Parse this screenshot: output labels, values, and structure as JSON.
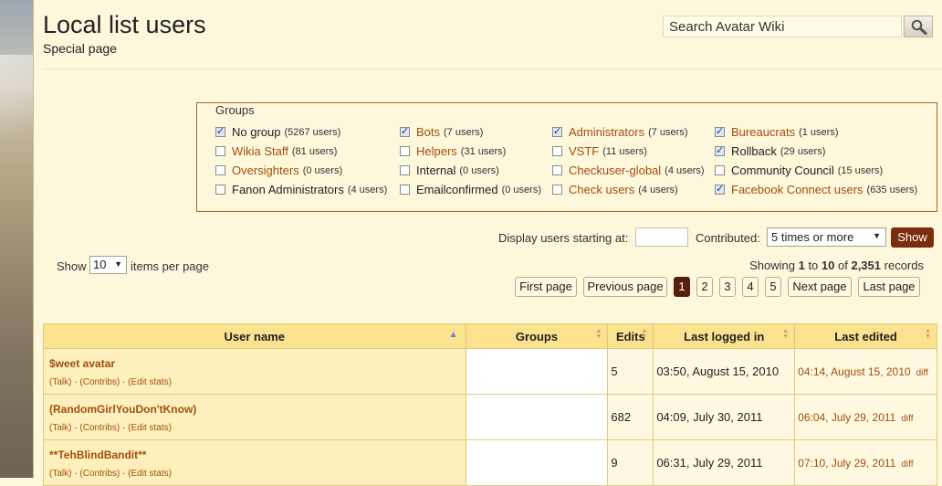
{
  "header": {
    "title": "Local list users",
    "subtitle": "Special page",
    "search_placeholder": "Search Avatar Wiki"
  },
  "groups": {
    "legend": "Groups",
    "items": [
      {
        "label": "No group",
        "count": "(5267 users)",
        "checked": true,
        "link": false
      },
      {
        "label": "Bots",
        "count": "(7 users)",
        "checked": true,
        "link": true
      },
      {
        "label": "Administrators",
        "count": "(7 users)",
        "checked": true,
        "link": true
      },
      {
        "label": "Bureaucrats",
        "count": "(1 users)",
        "checked": true,
        "link": true
      },
      {
        "label": "Wikia Staff",
        "count": "(81 users)",
        "checked": false,
        "link": true
      },
      {
        "label": "Helpers",
        "count": "(31 users)",
        "checked": false,
        "link": true
      },
      {
        "label": "VSTF",
        "count": "(11 users)",
        "checked": false,
        "link": true
      },
      {
        "label": "Rollback",
        "count": "(29 users)",
        "checked": true,
        "link": false
      },
      {
        "label": "Oversighters",
        "count": "(0 users)",
        "checked": false,
        "link": true
      },
      {
        "label": "Internal",
        "count": "(0 users)",
        "checked": false,
        "link": false
      },
      {
        "label": "Checkuser-global",
        "count": "(4 users)",
        "checked": false,
        "link": true
      },
      {
        "label": "Community Council",
        "count": "(15 users)",
        "checked": false,
        "link": false
      },
      {
        "label": "Fanon Administrators",
        "count": "(4 users)",
        "checked": false,
        "link": false
      },
      {
        "label": "Emailconfirmed",
        "count": "(0 users)",
        "checked": false,
        "link": false
      },
      {
        "label": "Check users",
        "count": "(4 users)",
        "checked": false,
        "link": true
      },
      {
        "label": "Facebook Connect users",
        "count": "(635 users)",
        "checked": true,
        "link": true
      }
    ]
  },
  "filters": {
    "display_label": "Display users starting at:",
    "display_value": "",
    "contributed_label": "Contributed:",
    "contributed_value": "5 times or more",
    "show_button": "Show"
  },
  "paging": {
    "show_label": "Show",
    "items_value": "10",
    "items_label": "items per page",
    "records_prefix": "Showing",
    "records_from": "1",
    "records_to_word": "to",
    "records_to": "10",
    "records_of_word": "of",
    "records_total": "2,351",
    "records_suffix": "records",
    "first": "First page",
    "previous": "Previous page",
    "pages": [
      "1",
      "2",
      "3",
      "4",
      "5"
    ],
    "active_page": "1",
    "next": "Next page",
    "last": "Last page"
  },
  "table": {
    "columns": [
      "User name",
      "Groups",
      "Edits",
      "Last logged in",
      "Last edited"
    ],
    "links": {
      "talk": "(Talk)",
      "contribs": "(Contribs)",
      "editstats": "(Edit stats)",
      "sep": "·"
    },
    "rows": [
      {
        "name": "$weet avatar",
        "groups": "",
        "edits": "5",
        "logged": "03:50, August 15, 2010",
        "edited": "04:14, August 15, 2010",
        "diff": "diff"
      },
      {
        "name": "(RandomGirlYouDon'tKnow)",
        "groups": "",
        "edits": "682",
        "logged": "04:09, July 30, 2011",
        "edited": "06:04, July 29, 2011",
        "diff": "diff"
      },
      {
        "name": "**TehBlindBandit**",
        "groups": "",
        "edits": "9",
        "logged": "06:31, July 29, 2011",
        "edited": "07:10, July 29, 2011",
        "diff": "diff"
      }
    ]
  },
  "colors": {
    "accent": "#a04f0d",
    "button": "#7a2d0f",
    "header": "#fbe28f",
    "background": "#fdf7dc"
  }
}
